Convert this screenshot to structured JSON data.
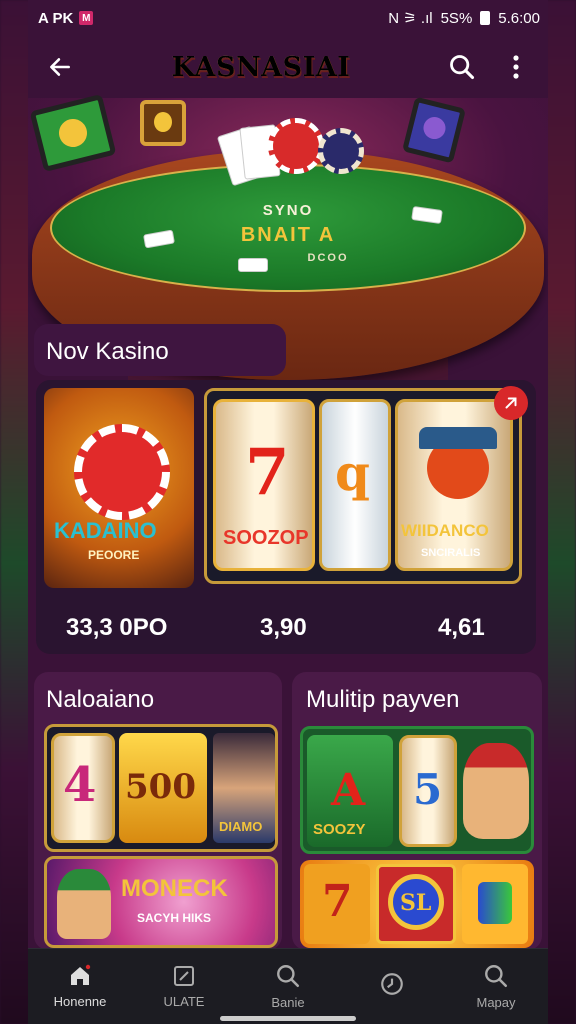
{
  "status_bar": {
    "left_text": "A PK",
    "badge": "M",
    "right_icons": "N ⚞ .ıl",
    "battery_text": "5S%",
    "time": "5.6:00"
  },
  "top_bar": {
    "brand": "KASNASIAI",
    "back_icon": "arrow-left-icon",
    "search_icon": "search-icon",
    "menu_icon": "more-vertical-icon"
  },
  "hero": {
    "line1": "SYNO",
    "line2": "BNAIT A",
    "line3": "DCOO"
  },
  "section_new": {
    "title": "Nov Kasino",
    "tiles": [
      {
        "title": "KADAINO",
        "subtitle": "PEOORE",
        "score": "33,3 0PO"
      },
      {
        "title": "SOOZOP",
        "score": "3,90"
      },
      {
        "title": "WIIDANCO",
        "subtitle": "SNCIRALIS",
        "score": "4,61"
      }
    ],
    "badge_icon": "link-icon"
  },
  "section_left": {
    "title": "Naloaiano",
    "tiles": [
      {
        "reel1": "4",
        "reel2": "500",
        "label": "DIAMO"
      },
      {
        "title": "MONECK",
        "subtitle": "SACYH HIKS"
      }
    ]
  },
  "section_right": {
    "title": "Mulitip payven",
    "tiles": [
      {
        "symbol1": "A",
        "symbol2": "5",
        "label": "SOOZY"
      },
      {
        "symbol1": "7",
        "symbol2": "SL"
      }
    ]
  },
  "bottom_nav": [
    {
      "label": "Honenne",
      "icon": "home-icon",
      "active": true
    },
    {
      "label": "ULATE",
      "icon": "edit-icon",
      "active": false
    },
    {
      "label": "Banie",
      "icon": "search-icon",
      "active": false
    },
    {
      "label": "",
      "icon": "clock-icon",
      "active": false
    },
    {
      "label": "Mapay",
      "icon": "search-icon",
      "active": false
    }
  ],
  "colors": {
    "accent_gold": "#f5c537",
    "felt_green": "#1b7a28",
    "card_bg": "#4a1a47",
    "nav_bg": "#1c1c22"
  }
}
